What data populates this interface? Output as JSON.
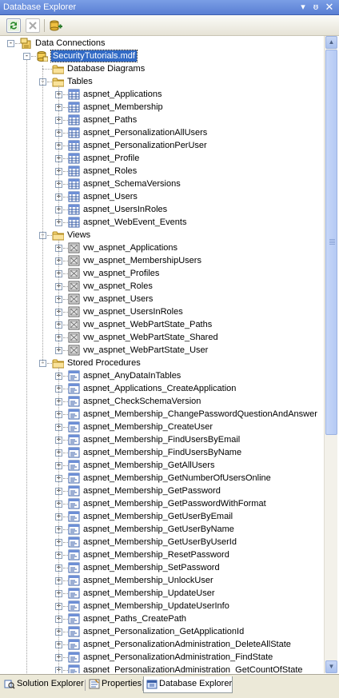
{
  "window": {
    "title": "Database Explorer"
  },
  "tree": {
    "root": "Data Connections",
    "database": "SecurityTutorials.mdf",
    "diagrams": "Database Diagrams",
    "tables_label": "Tables",
    "tables": [
      "aspnet_Applications",
      "aspnet_Membership",
      "aspnet_Paths",
      "aspnet_PersonalizationAllUsers",
      "aspnet_PersonalizationPerUser",
      "aspnet_Profile",
      "aspnet_Roles",
      "aspnet_SchemaVersions",
      "aspnet_Users",
      "aspnet_UsersInRoles",
      "aspnet_WebEvent_Events"
    ],
    "views_label": "Views",
    "views": [
      "vw_aspnet_Applications",
      "vw_aspnet_MembershipUsers",
      "vw_aspnet_Profiles",
      "vw_aspnet_Roles",
      "vw_aspnet_Users",
      "vw_aspnet_UsersInRoles",
      "vw_aspnet_WebPartState_Paths",
      "vw_aspnet_WebPartState_Shared",
      "vw_aspnet_WebPartState_User"
    ],
    "procs_label": "Stored Procedures",
    "procs": [
      "aspnet_AnyDataInTables",
      "aspnet_Applications_CreateApplication",
      "aspnet_CheckSchemaVersion",
      "aspnet_Membership_ChangePasswordQuestionAndAnswer",
      "aspnet_Membership_CreateUser",
      "aspnet_Membership_FindUsersByEmail",
      "aspnet_Membership_FindUsersByName",
      "aspnet_Membership_GetAllUsers",
      "aspnet_Membership_GetNumberOfUsersOnline",
      "aspnet_Membership_GetPassword",
      "aspnet_Membership_GetPasswordWithFormat",
      "aspnet_Membership_GetUserByEmail",
      "aspnet_Membership_GetUserByName",
      "aspnet_Membership_GetUserByUserId",
      "aspnet_Membership_ResetPassword",
      "aspnet_Membership_SetPassword",
      "aspnet_Membership_UnlockUser",
      "aspnet_Membership_UpdateUser",
      "aspnet_Membership_UpdateUserInfo",
      "aspnet_Paths_CreatePath",
      "aspnet_Personalization_GetApplicationId",
      "aspnet_PersonalizationAdministration_DeleteAllState",
      "aspnet_PersonalizationAdministration_FindState",
      "aspnet_PersonalizationAdministration_GetCountOfState"
    ]
  },
  "tabs": [
    {
      "label": "Solution Explorer",
      "icon": "solution-explorer-icon"
    },
    {
      "label": "Properties",
      "icon": "properties-icon"
    },
    {
      "label": "Database Explorer",
      "icon": "database-explorer-icon",
      "active": true
    }
  ],
  "colors": {
    "selection": "#316ac5",
    "titlebar": "#6b8fdc"
  }
}
